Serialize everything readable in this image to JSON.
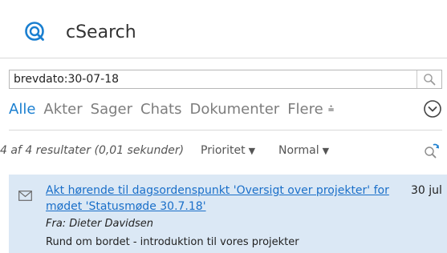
{
  "app": {
    "title": "cSearch",
    "logo_icon": "search-logo-icon",
    "accent_color": "#1a7fd0"
  },
  "search": {
    "value": "brevdato:30-07-18",
    "button_icon": "search-icon"
  },
  "tabs": [
    {
      "label": "Alle",
      "active": true
    },
    {
      "label": "Akter",
      "active": false
    },
    {
      "label": "Sager",
      "active": false
    },
    {
      "label": "Chats",
      "active": false
    },
    {
      "label": "Dokumenter",
      "active": false
    },
    {
      "label": "Flere",
      "active": false
    }
  ],
  "tabs_more_icon": "filter-arrow-icon",
  "tabs_expand_icon": "chevron-down-circle-icon",
  "results": {
    "count_text": "4 af 4 resultater (0,01 sekunder)",
    "sort_label": "Prioritet",
    "order_label": "Normal",
    "refresh_icon": "refresh-search-icon"
  },
  "items": [
    {
      "icon": "mail-icon",
      "title": "Akt hørende til dagsordenspunkt 'Oversigt over projekter' for mødet 'Statusmøde 30.7.18'",
      "date": "30 jul",
      "from": "Fra: Dieter Davidsen",
      "snippet": "Rund om bordet - introduktion til vores projekter"
    }
  ]
}
